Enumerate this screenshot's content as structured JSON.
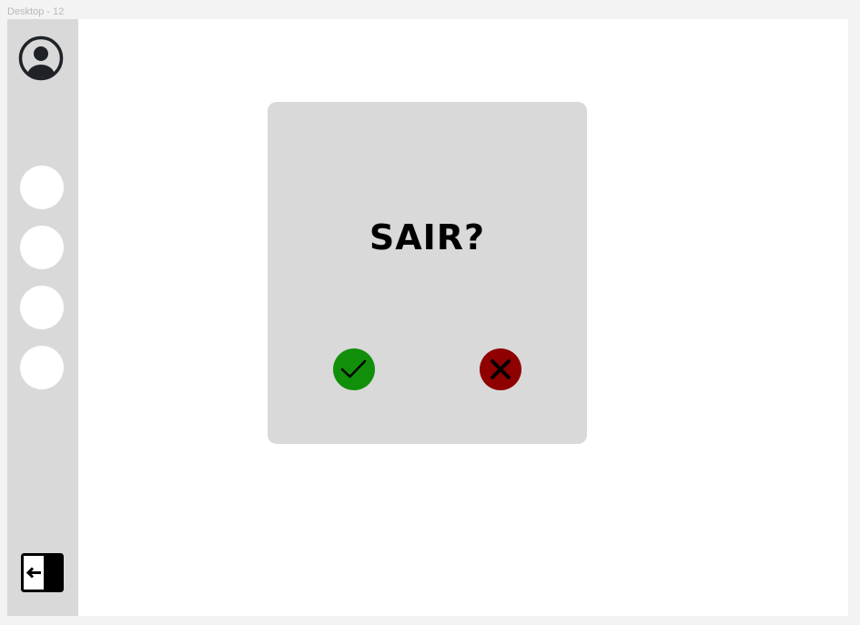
{
  "frame": {
    "label": "Desktop - 12"
  },
  "sidebar": {
    "avatar_icon": "user-circle-icon",
    "nav_items": [
      {
        "icon": "circle"
      },
      {
        "icon": "circle"
      },
      {
        "icon": "circle"
      },
      {
        "icon": "circle"
      }
    ],
    "logout_icon": "logout-arrow-icon"
  },
  "dialog": {
    "title": "SAIR?",
    "confirm_icon": "checkmark-icon",
    "cancel_icon": "close-x-icon"
  },
  "colors": {
    "page_background": "#f3f3f3",
    "canvas": "#ffffff",
    "sidebar": "#d9d9d9",
    "dialog": "#d9d9d9",
    "confirm": "#128f0a",
    "cancel": "#8f0000",
    "icon_dark": "#1f2328"
  }
}
